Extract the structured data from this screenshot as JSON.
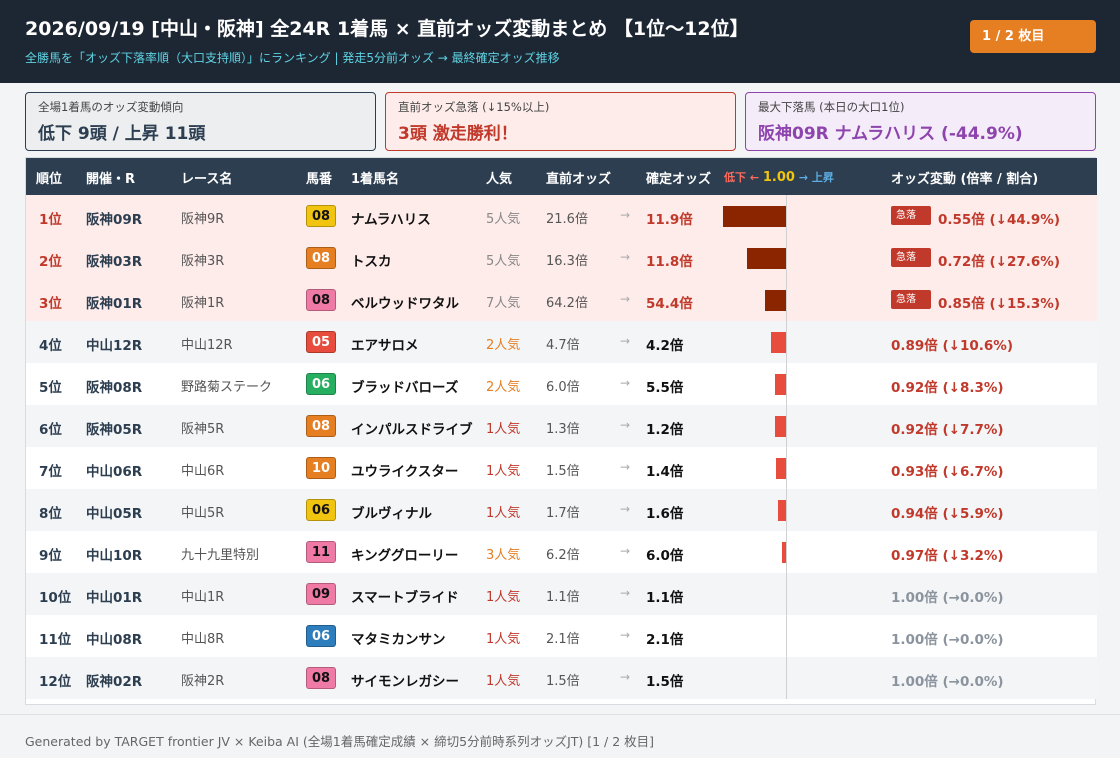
{
  "header": {
    "title": "2026/09/19 [中山・阪神] 全24R 1着馬 × 直前オッズ変動まとめ 【1位〜12位】",
    "subtitle": "全勝馬を「オッズ下落率順（大口支持順）」にランキング | 発走5分前オッズ → 最終確定オッズ推移",
    "page_badge": "1 / 2 枚目"
  },
  "cards": [
    {
      "label": "全場1着馬のオッズ変動傾向",
      "value": "低下 9頭 / 上昇 11頭"
    },
    {
      "label": "直前オッズ急落 (↓15%以上)",
      "value": "3頭 激走勝利！"
    },
    {
      "label": "最大下落馬 (本日の大口1位)",
      "value": "阪神09R ナムラハリス (-44.9%)"
    }
  ],
  "table": {
    "headers": {
      "rank": "順位",
      "venue": "開催・R",
      "race": "レース名",
      "num": "馬番",
      "horse": "1着馬名",
      "pop": "人気",
      "pre": "直前オッズ",
      "fin": "確定オッズ",
      "change": "オッズ変動 (倍率 / 割合)"
    },
    "legend": {
      "down": "低下 ←",
      "mid": "1.00",
      "up": "→ 上昇"
    },
    "rows": [
      {
        "rank": "1位",
        "venue": "阪神09R",
        "race": "阪神9R",
        "num": "08",
        "num_color": "#f1c40f",
        "num_text": "#111111",
        "horse": "ナムラハリス",
        "pop": "5人気",
        "pop_rank": 5,
        "pre": "21.6倍",
        "fin": "11.9倍",
        "ratio": 0.55,
        "surge": true,
        "surge_label": "急落",
        "change": "0.55倍 (↓44.9%)"
      },
      {
        "rank": "2位",
        "venue": "阪神03R",
        "race": "阪神3R",
        "num": "08",
        "num_color": "#e67e22",
        "num_text": "#ffffff",
        "horse": "トスカ",
        "pop": "5人気",
        "pop_rank": 5,
        "pre": "16.3倍",
        "fin": "11.8倍",
        "ratio": 0.72,
        "surge": true,
        "surge_label": "急落",
        "change": "0.72倍 (↓27.6%)"
      },
      {
        "rank": "3位",
        "venue": "阪神01R",
        "race": "阪神1R",
        "num": "08",
        "num_color": "#f07aa6",
        "num_text": "#111111",
        "horse": "ベルウッドワタル",
        "pop": "7人気",
        "pop_rank": 7,
        "pre": "64.2倍",
        "fin": "54.4倍",
        "ratio": 0.85,
        "surge": true,
        "surge_label": "急落",
        "change": "0.85倍 (↓15.3%)"
      },
      {
        "rank": "4位",
        "venue": "中山12R",
        "race": "中山12R",
        "num": "05",
        "num_color": "#e74c3c",
        "num_text": "#ffffff",
        "horse": "エアサロメ",
        "pop": "2人気",
        "pop_rank": 2,
        "pre": "4.7倍",
        "fin": "4.2倍",
        "ratio": 0.89,
        "surge": false,
        "change": "0.89倍 (↓10.6%)"
      },
      {
        "rank": "5位",
        "venue": "阪神08R",
        "race": "野路菊ステーク",
        "num": "06",
        "num_color": "#27ae60",
        "num_text": "#ffffff",
        "horse": "ブラッドバローズ",
        "pop": "2人気",
        "pop_rank": 2,
        "pre": "6.0倍",
        "fin": "5.5倍",
        "ratio": 0.92,
        "surge": false,
        "change": "0.92倍 (↓8.3%)"
      },
      {
        "rank": "6位",
        "venue": "阪神05R",
        "race": "阪神5R",
        "num": "08",
        "num_color": "#e67e22",
        "num_text": "#ffffff",
        "horse": "インパルスドライブ",
        "pop": "1人気",
        "pop_rank": 1,
        "pre": "1.3倍",
        "fin": "1.2倍",
        "ratio": 0.92,
        "surge": false,
        "change": "0.92倍 (↓7.7%)"
      },
      {
        "rank": "7位",
        "venue": "中山06R",
        "race": "中山6R",
        "num": "10",
        "num_color": "#e67e22",
        "num_text": "#ffffff",
        "horse": "ユウライクスター",
        "pop": "1人気",
        "pop_rank": 1,
        "pre": "1.5倍",
        "fin": "1.4倍",
        "ratio": 0.93,
        "surge": false,
        "change": "0.93倍 (↓6.7%)"
      },
      {
        "rank": "8位",
        "venue": "中山05R",
        "race": "中山5R",
        "num": "06",
        "num_color": "#f1c40f",
        "num_text": "#111111",
        "horse": "ブルヴィナル",
        "pop": "1人気",
        "pop_rank": 1,
        "pre": "1.7倍",
        "fin": "1.6倍",
        "ratio": 0.94,
        "surge": false,
        "change": "0.94倍 (↓5.9%)"
      },
      {
        "rank": "9位",
        "venue": "中山10R",
        "race": "九十九里特別",
        "num": "11",
        "num_color": "#f07aa6",
        "num_text": "#111111",
        "horse": "キンググローリー",
        "pop": "3人気",
        "pop_rank": 3,
        "pre": "6.2倍",
        "fin": "6.0倍",
        "ratio": 0.97,
        "surge": false,
        "change": "0.97倍 (↓3.2%)"
      },
      {
        "rank": "10位",
        "venue": "中山01R",
        "race": "中山1R",
        "num": "09",
        "num_color": "#f07aa6",
        "num_text": "#111111",
        "horse": "スマートブライド",
        "pop": "1人気",
        "pop_rank": 1,
        "pre": "1.1倍",
        "fin": "1.1倍",
        "ratio": 1.0,
        "surge": false,
        "change": "1.00倍 (→0.0%)"
      },
      {
        "rank": "11位",
        "venue": "中山08R",
        "race": "中山8R",
        "num": "06",
        "num_color": "#2e7dbd",
        "num_text": "#ffffff",
        "horse": "マタミカンサン",
        "pop": "1人気",
        "pop_rank": 1,
        "pre": "2.1倍",
        "fin": "2.1倍",
        "ratio": 1.0,
        "surge": false,
        "change": "1.00倍 (→0.0%)"
      },
      {
        "rank": "12位",
        "venue": "阪神02R",
        "race": "阪神2R",
        "num": "08",
        "num_color": "#f07aa6",
        "num_text": "#111111",
        "horse": "サイモンレガシー",
        "pop": "1人気",
        "pop_rank": 1,
        "pre": "1.5倍",
        "fin": "1.5倍",
        "ratio": 1.0,
        "surge": false,
        "change": "1.00倍 (→0.0%)"
      }
    ]
  },
  "colors": {
    "bar_severe": "#8b2500",
    "bar_mild": "#e74c3c",
    "accent": "#e67e22"
  },
  "footer": "Generated by TARGET frontier JV × Keiba AI (全場1着馬確定成績 × 締切5分前時系列オッズJT) [1 / 2 枚目]"
}
